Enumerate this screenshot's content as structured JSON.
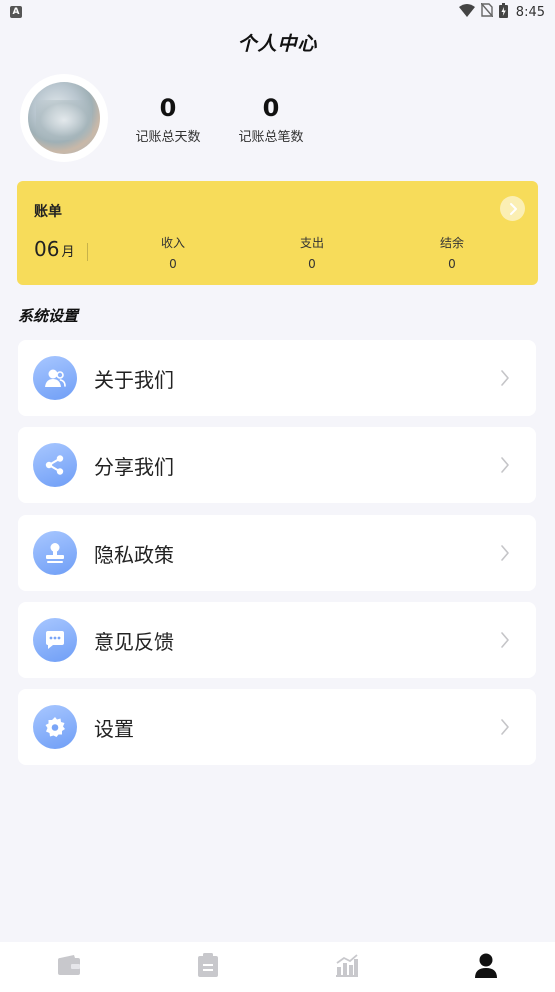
{
  "status_bar": {
    "badge": "A",
    "time": "8:45",
    "icons": [
      "wifi-icon",
      "no-sim-icon",
      "battery-icon"
    ]
  },
  "header": {
    "title": "个人中心"
  },
  "profile": {
    "stats": [
      {
        "value": "0",
        "label": "记账总天数"
      },
      {
        "value": "0",
        "label": "记账总笔数"
      }
    ]
  },
  "bill": {
    "title": "账单",
    "month": "06",
    "month_unit": "月",
    "columns": [
      {
        "label": "收入",
        "value": "0"
      },
      {
        "label": "支出",
        "value": "0"
      },
      {
        "label": "结余",
        "value": "0"
      }
    ]
  },
  "settings": {
    "section_title": "系统设置",
    "items": [
      {
        "label": "关于我们",
        "icon": "about-us-icon"
      },
      {
        "label": "分享我们",
        "icon": "share-icon"
      },
      {
        "label": "隐私政策",
        "icon": "privacy-stamp-icon"
      },
      {
        "label": "意见反馈",
        "icon": "feedback-chat-icon"
      },
      {
        "label": "设置",
        "icon": "gear-icon"
      }
    ]
  },
  "bottom_nav": {
    "items": [
      {
        "icon": "wallet-icon",
        "active": false
      },
      {
        "icon": "clipboard-icon",
        "active": false
      },
      {
        "icon": "chart-icon",
        "active": false
      },
      {
        "icon": "profile-icon",
        "active": true
      }
    ]
  },
  "colors": {
    "background": "#f5f5fa",
    "bill_card": "#f7dc5a",
    "icon_blue": "#6f9ef6",
    "nav_inactive": "#c8c8cc",
    "nav_active": "#111111"
  }
}
